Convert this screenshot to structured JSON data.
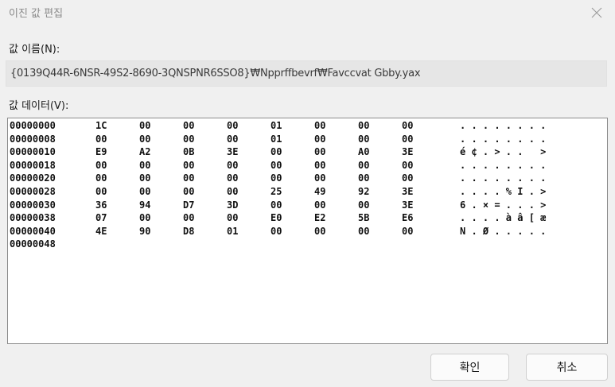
{
  "dialog": {
    "title": "이진 값 편집",
    "close_icon": "close-icon"
  },
  "value_name": {
    "label": "값 이름(N):",
    "value": "{0139Q44R-6NSR-49S2-8690-3QNSPNR6SSO8}₩Npprffbevrf₩Favccvat Gbby.yax"
  },
  "value_data": {
    "label": "값 데이터(V):",
    "rows": [
      {
        "offset": "00000000",
        "bytes": [
          "1C",
          "00",
          "00",
          "00",
          "01",
          "00",
          "00",
          "00"
        ],
        "ascii": ". . . . . . . ."
      },
      {
        "offset": "00000008",
        "bytes": [
          "00",
          "00",
          "00",
          "00",
          "01",
          "00",
          "00",
          "00"
        ],
        "ascii": ". . . . . . . ."
      },
      {
        "offset": "00000010",
        "bytes": [
          "E9",
          "A2",
          "0B",
          "3E",
          "00",
          "00",
          "A0",
          "3E"
        ],
        "ascii": "é ¢ . > . .   >"
      },
      {
        "offset": "00000018",
        "bytes": [
          "00",
          "00",
          "00",
          "00",
          "00",
          "00",
          "00",
          "00"
        ],
        "ascii": ". . . . . . . ."
      },
      {
        "offset": "00000020",
        "bytes": [
          "00",
          "00",
          "00",
          "00",
          "00",
          "00",
          "00",
          "00"
        ],
        "ascii": ". . . . . . . ."
      },
      {
        "offset": "00000028",
        "bytes": [
          "00",
          "00",
          "00",
          "00",
          "25",
          "49",
          "92",
          "3E"
        ],
        "ascii": ". . . . % I . >"
      },
      {
        "offset": "00000030",
        "bytes": [
          "36",
          "94",
          "D7",
          "3D",
          "00",
          "00",
          "00",
          "3E"
        ],
        "ascii": "6 . × = . . . >"
      },
      {
        "offset": "00000038",
        "bytes": [
          "07",
          "00",
          "00",
          "00",
          "E0",
          "E2",
          "5B",
          "E6"
        ],
        "ascii": ". . . . à â [ æ"
      },
      {
        "offset": "00000040",
        "bytes": [
          "4E",
          "90",
          "D8",
          "01",
          "00",
          "00",
          "00",
          "00"
        ],
        "ascii": "N . Ø . . . . ."
      },
      {
        "offset": "00000048",
        "bytes": [],
        "ascii": ""
      }
    ]
  },
  "buttons": {
    "ok": "확인",
    "cancel": "취소"
  }
}
